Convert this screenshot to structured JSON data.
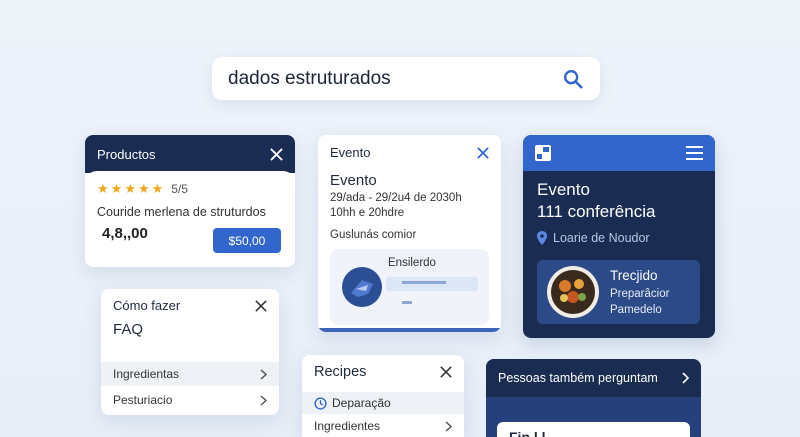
{
  "search": {
    "query": "dados estruturados"
  },
  "productos": {
    "title": "Productos",
    "rating": "5/5",
    "description": "Couride merlena de struturdos",
    "number": "4,8,,00",
    "price": "$50,00"
  },
  "evento_card": {
    "header": "Evento",
    "title": "Evento",
    "line1": "29/ada - 29/2u4 de 2030h",
    "line2": "10hh  e 20hdre",
    "subtitle": "Guslunás comior",
    "inner_label": "Ensilerdo"
  },
  "evento_dark": {
    "title_line1": "Evento",
    "title_line2": "111 conferência",
    "location": "Loarie de Noudor",
    "inner_title": "Trecjido",
    "inner_line1": "Preparâcior",
    "inner_line2": "Pamedelo"
  },
  "faq": {
    "header": "Cómo fazer",
    "title": "FAQ",
    "items": [
      "Ingredientas",
      "Pesturiacio"
    ]
  },
  "recipes": {
    "header": "Recipes",
    "items": [
      "Deparação",
      "Ingredientes"
    ]
  },
  "pessoas": {
    "header": "Pessoas também perguntam",
    "inner_text": "Fin  l    l"
  },
  "colors": {
    "navy": "#1a2c52",
    "accent_blue": "#3366cc",
    "star": "#f2a51a",
    "background": "#eef3fa"
  }
}
